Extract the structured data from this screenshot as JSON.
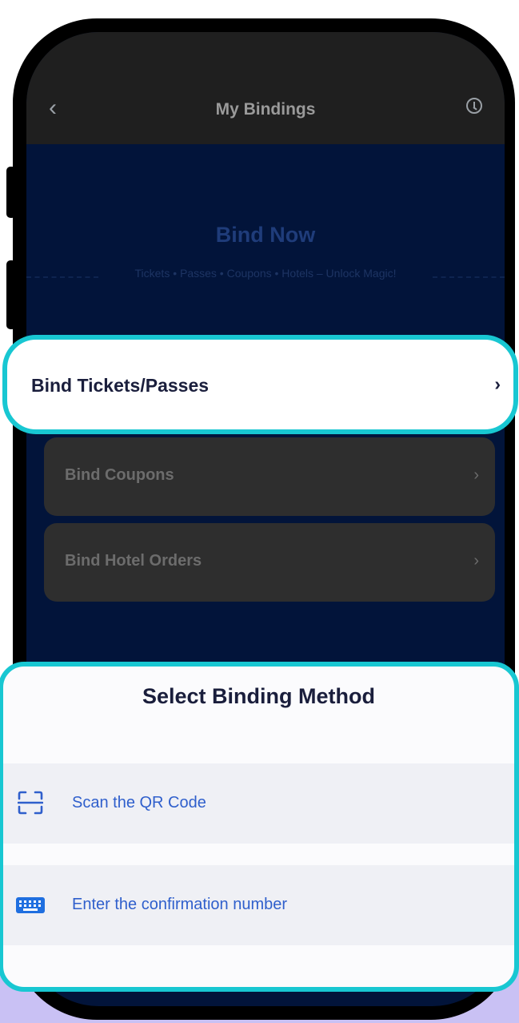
{
  "nav": {
    "back_icon": "chevron-left-icon",
    "title": "My Bindings",
    "history_icon": "clock-icon"
  },
  "hero": {
    "title": "Bind Now",
    "subtitle": "Tickets • Passes • Coupons • Hotels – Unlock Magic!"
  },
  "bind_items": [
    {
      "label": "Bind Tickets/Passes",
      "highlighted": true
    },
    {
      "label": "Bind Coupons"
    },
    {
      "label": "Bind Hotel Orders"
    }
  ],
  "chevron": "›",
  "sheet": {
    "title": "Select Binding Method",
    "options": [
      {
        "label": "Scan the QR Code",
        "icon": "scan-icon"
      },
      {
        "label": "Enter the confirmation number",
        "icon": "keyboard-icon"
      }
    ]
  },
  "colors": {
    "highlight": "#18c7d2",
    "accent_blue": "#2f5fcc",
    "dark_navy": "#02143a",
    "lilac": "#c9c1f4"
  }
}
